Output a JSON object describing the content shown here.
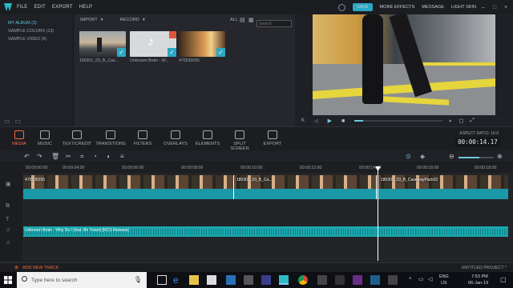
{
  "menu": {
    "items": [
      "FILE",
      "EDIT",
      "EXPORT",
      "HELP"
    ],
    "save": "SAVE",
    "more_effects": "MORE EFFECTS",
    "message": "MESSAGE",
    "light_skin": "LIGHT SKIN"
  },
  "library": {
    "items": [
      {
        "label": "MY ALBUM (3)",
        "active": true
      },
      {
        "label": "SAMPLE COLORS (13)",
        "active": false
      },
      {
        "label": "SAMPLE VIDEO (9)",
        "active": false
      }
    ]
  },
  "media": {
    "import": "IMPORT",
    "record": "RECORD",
    "filter_all": "ALL",
    "search_placeholder": "Search",
    "items": [
      {
        "caption": "180301_03_B_Cas...",
        "kind": "video"
      },
      {
        "caption": "Unknown Brain - W...",
        "kind": "audio"
      },
      {
        "caption": "470535055",
        "kind": "video"
      }
    ]
  },
  "tabs": [
    "MEDIA",
    "MUSIC",
    "TEXT/CREDIT",
    "TRANSITIONS",
    "FILTERS",
    "OVERLAYS",
    "ELEMENTS",
    "SPLIT SCREEN",
    "EXPORT"
  ],
  "active_tab": "MEDIA",
  "aspect": {
    "label": "ASPECT RATIO: 16:9",
    "timecode": "00:00:14.17"
  },
  "ruler": [
    "00:00:00:00",
    "00:00:04:00",
    "00:00:06:00",
    "00:00:08:00",
    "00:00:10:00",
    "00:00:12:00",
    "00:00:14:00",
    "00:00:16:00",
    "00:00:18:00"
  ],
  "timeline": {
    "video_clips": [
      {
        "label": "470535055"
      },
      {
        "label": "180301_03_B_Ca..."
      },
      {
        "label": "180301_03_B_CasewayPack02"
      }
    ],
    "audio_clip": "Unknown Brain - Why Do I (feat. Bri Tolani) [NCS Release]"
  },
  "footer": {
    "add_track": "ADD NEW TRACK",
    "project": "UNTITLED PROJECT *"
  },
  "taskbar": {
    "search": "Type here to search",
    "lang": "ENG",
    "region": "US",
    "time": "7:53 PM",
    "date": "06-Jan-19"
  },
  "colors": {
    "accent": "#2aa8c4",
    "active_tab": "#ff6a3d",
    "video_track": "#1b98a8",
    "audio_track": "#1aa7ae"
  }
}
